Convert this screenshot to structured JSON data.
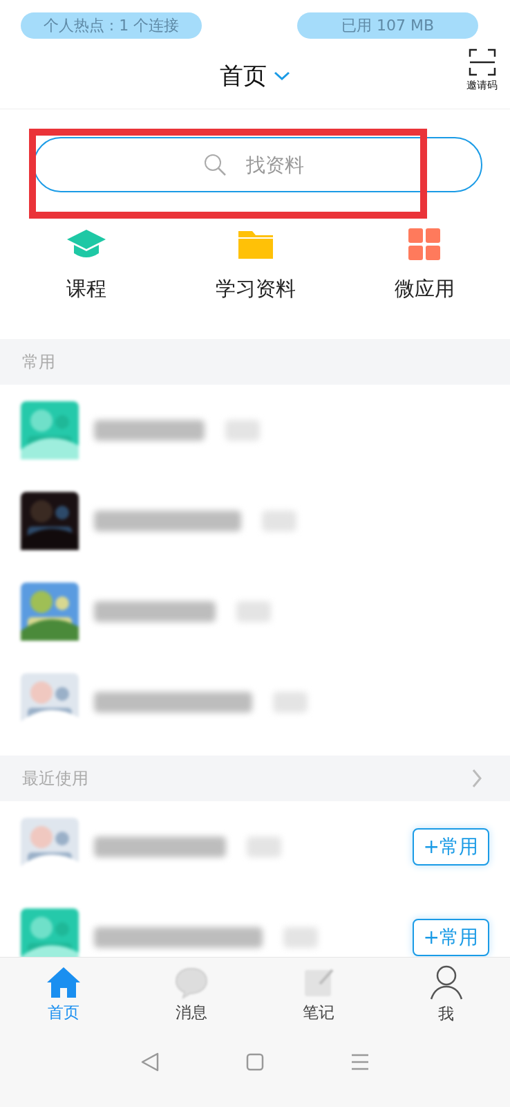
{
  "status_pills": [
    "个人热点 : 1 个连接",
    "已用 107 MB"
  ],
  "header": {
    "title": "首页",
    "invite_label": "邀请码"
  },
  "search": {
    "placeholder": "找资料"
  },
  "shortcuts": [
    {
      "label": "课程",
      "kind": "course"
    },
    {
      "label": "学习资料",
      "kind": "folder"
    },
    {
      "label": "微应用",
      "kind": "apps"
    }
  ],
  "sections": [
    {
      "title": "常用",
      "chevron": false
    },
    {
      "title": "最近使用",
      "chevron": true,
      "rows": [
        {
          "kind": "picture",
          "button": "+常用"
        },
        {
          "kind": "picture",
          "button": "+常用"
        }
      ]
    }
  ],
  "tabs": [
    {
      "label": "首页",
      "kind": "home",
      "selected": true
    },
    {
      "label": "消息",
      "kind": "chat",
      "selected": false
    },
    {
      "label": "笔记",
      "kind": "note",
      "selected": false
    },
    {
      "label": "我",
      "kind": "person",
      "selected": false
    }
  ]
}
